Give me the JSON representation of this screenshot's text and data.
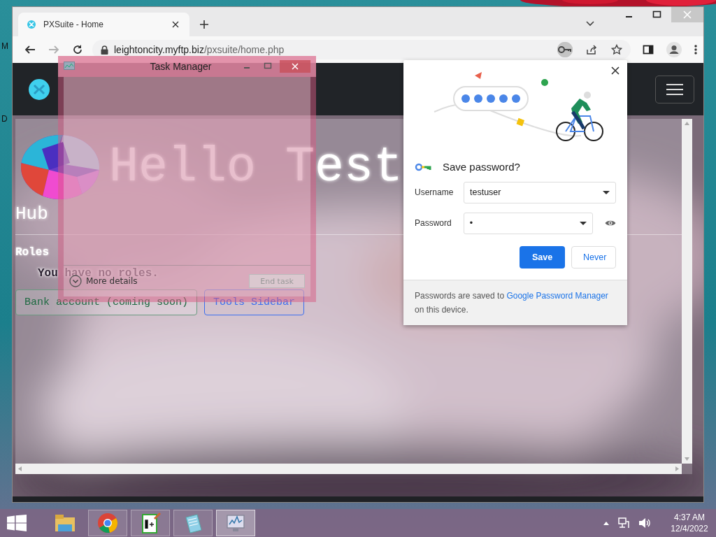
{
  "desktop": {
    "icon_labels": [
      "M",
      "D"
    ]
  },
  "browser": {
    "tab": {
      "title": "PXSuite - Home",
      "selected": true
    },
    "forward_disabled": true,
    "address": {
      "host": "leightoncity.myftp.biz",
      "path": "/pxsuite/home.php"
    },
    "password_key_active": true
  },
  "page": {
    "heading": "Hello Test",
    "subheading": "Hub",
    "roles_label": "Roles",
    "roles_message": "You have no roles.",
    "buttons": [
      {
        "label": "Bank account (coming soon)",
        "kind": "success",
        "disabled": true
      },
      {
        "label": "Tools Sidebar",
        "kind": "primary",
        "disabled": false
      }
    ]
  },
  "task_manager": {
    "title": "Task Manager",
    "more_details": "More details",
    "end_task": {
      "label": "End task",
      "disabled": true
    }
  },
  "password_dialog": {
    "title": "Save password?",
    "fields": [
      {
        "label": "Username",
        "value": "testuser",
        "reveal": false
      },
      {
        "label": "Password",
        "value": "•",
        "reveal": true
      }
    ],
    "buttons": [
      {
        "label": "Save",
        "kind": "primary"
      },
      {
        "label": "Never",
        "kind": "secondary"
      }
    ],
    "footer": {
      "before": "Passwords are saved to ",
      "link": "Google Password Manager",
      "after": " on this device."
    }
  },
  "taskbar": {
    "apps": [
      {
        "kind": "explorer",
        "running": false,
        "selected": false
      },
      {
        "kind": "chrome",
        "running": true,
        "selected": false
      },
      {
        "kind": "notepadpp",
        "running": true,
        "selected": false
      },
      {
        "kind": "notepad",
        "running": true,
        "selected": false
      },
      {
        "kind": "taskmgr",
        "running": true,
        "selected": true
      }
    ],
    "time": "4:37 AM",
    "date": "12/4/2022"
  }
}
